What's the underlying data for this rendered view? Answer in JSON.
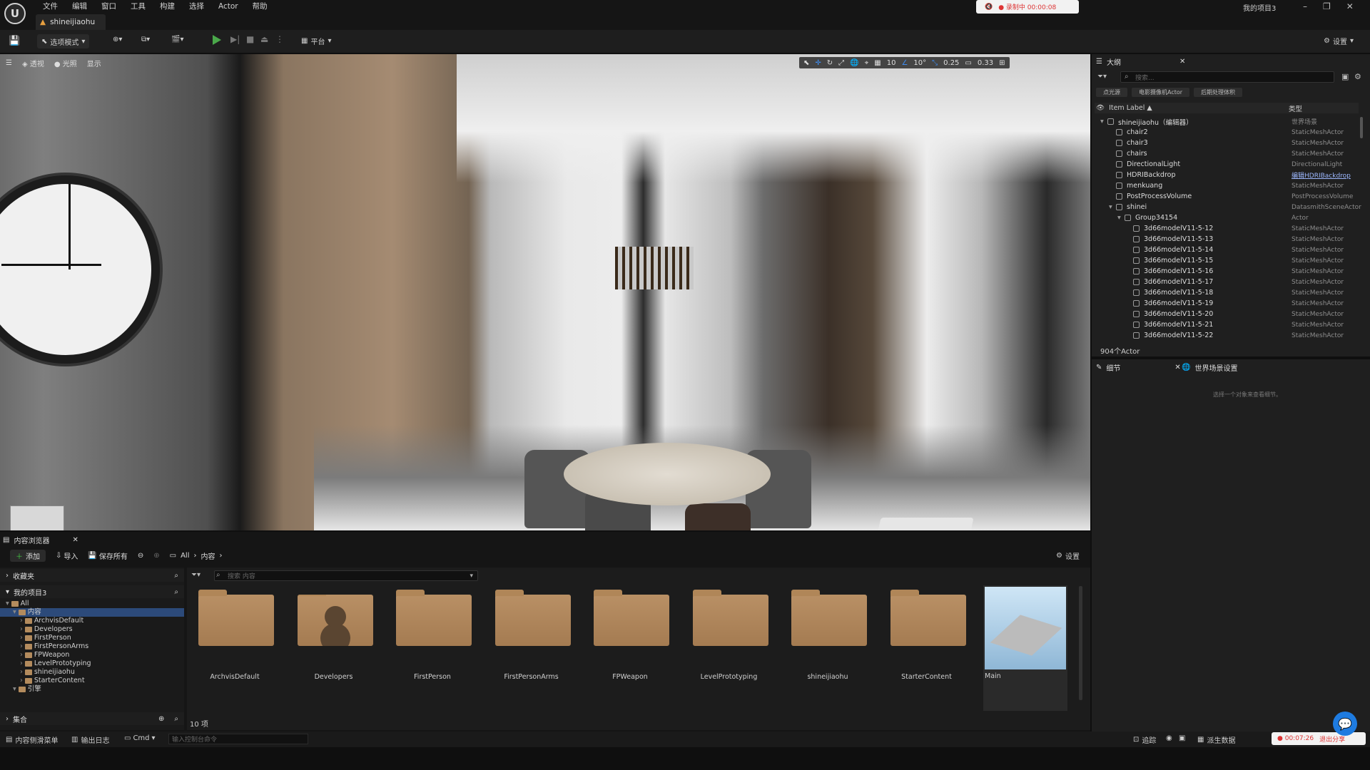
{
  "menu": [
    "文件",
    "编辑",
    "窗口",
    "工具",
    "构建",
    "选择",
    "Actor",
    "帮助"
  ],
  "doc_tab": "shineijiaohu",
  "recording": {
    "status": "● 录制中 00:00:08"
  },
  "project_name": "我的项目3",
  "toolbar": {
    "mode_label": "选项模式",
    "platform_label": "平台",
    "settings_label": "设置"
  },
  "viewport": {
    "view_mode": "透视",
    "lighting": "光照",
    "show": "显示",
    "grid_snap": "10",
    "rotate_snap": "10°",
    "scale_snap": "0.25",
    "camera_speed": "0.33"
  },
  "outliner": {
    "tab": "大纲",
    "search_placeholder": "搜索...",
    "filters": [
      "点光源",
      "电影摄像机Actor",
      "后期处理体积"
    ],
    "col_label": "Item Label ▲",
    "col_type": "类型",
    "rows": [
      {
        "label": "shineijiaohu（编辑器）",
        "type": "世界场景",
        "indent": 0,
        "link": false
      },
      {
        "label": "chair2",
        "type": "StaticMeshActor",
        "indent": 1,
        "link": false
      },
      {
        "label": "chair3",
        "type": "StaticMeshActor",
        "indent": 1,
        "link": false
      },
      {
        "label": "chairs",
        "type": "StaticMeshActor",
        "indent": 1,
        "link": false
      },
      {
        "label": "DirectionalLight",
        "type": "DirectionalLight",
        "indent": 1,
        "link": false
      },
      {
        "label": "HDRIBackdrop",
        "type": "编辑HDRIBackdrop",
        "indent": 1,
        "link": true
      },
      {
        "label": "menkuang",
        "type": "StaticMeshActor",
        "indent": 1,
        "link": false
      },
      {
        "label": "PostProcessVolume",
        "type": "PostProcessVolume",
        "indent": 1,
        "link": false
      },
      {
        "label": "shinei",
        "type": "DatasmithSceneActor",
        "indent": 1,
        "link": false
      },
      {
        "label": "Group34154",
        "type": "Actor",
        "indent": 2,
        "link": false
      },
      {
        "label": "3d66modelV11-5-12",
        "type": "StaticMeshActor",
        "indent": 3,
        "link": false
      },
      {
        "label": "3d66modelV11-5-13",
        "type": "StaticMeshActor",
        "indent": 3,
        "link": false
      },
      {
        "label": "3d66modelV11-5-14",
        "type": "StaticMeshActor",
        "indent": 3,
        "link": false
      },
      {
        "label": "3d66modelV11-5-15",
        "type": "StaticMeshActor",
        "indent": 3,
        "link": false
      },
      {
        "label": "3d66modelV11-5-16",
        "type": "StaticMeshActor",
        "indent": 3,
        "link": false
      },
      {
        "label": "3d66modelV11-5-17",
        "type": "StaticMeshActor",
        "indent": 3,
        "link": false
      },
      {
        "label": "3d66modelV11-5-18",
        "type": "StaticMeshActor",
        "indent": 3,
        "link": false
      },
      {
        "label": "3d66modelV11-5-19",
        "type": "StaticMeshActor",
        "indent": 3,
        "link": false
      },
      {
        "label": "3d66modelV11-5-20",
        "type": "StaticMeshActor",
        "indent": 3,
        "link": false
      },
      {
        "label": "3d66modelV11-5-21",
        "type": "StaticMeshActor",
        "indent": 3,
        "link": false
      },
      {
        "label": "3d66modelV11-5-22",
        "type": "StaticMeshActor",
        "indent": 3,
        "link": false
      }
    ],
    "count": "904个Actor"
  },
  "details": {
    "tab": "细节",
    "tab2": "世界场景设置",
    "hint": "选择一个对象来查看细节。"
  },
  "content_browser": {
    "tab": "内容浏览器",
    "add": "添加",
    "import": "导入",
    "save_all": "保存所有",
    "path_all": "All",
    "path_content": "内容",
    "settings": "设置",
    "favorites": "收藏夹",
    "project": "我的项目3",
    "collections": "集合",
    "search_placeholder": "搜索 内容",
    "tree": [
      {
        "label": "All",
        "indent": 0,
        "selected": false
      },
      {
        "label": "内容",
        "indent": 1,
        "selected": true
      },
      {
        "label": "ArchvisDefault",
        "indent": 2,
        "selected": false
      },
      {
        "label": "Developers",
        "indent": 2,
        "selected": false
      },
      {
        "label": "FirstPerson",
        "indent": 2,
        "selected": false
      },
      {
        "label": "FirstPersonArms",
        "indent": 2,
        "selected": false
      },
      {
        "label": "FPWeapon",
        "indent": 2,
        "selected": false
      },
      {
        "label": "LevelPrototyping",
        "indent": 2,
        "selected": false
      },
      {
        "label": "shineijiaohu",
        "indent": 2,
        "selected": false
      },
      {
        "label": "StarterContent",
        "indent": 2,
        "selected": false
      },
      {
        "label": "引擎",
        "indent": 1,
        "selected": false
      }
    ],
    "folders": [
      "ArchvisDefault",
      "Developers",
      "FirstPerson",
      "FirstPersonArms",
      "FPWeapon",
      "LevelPrototyping",
      "shineijiaohu",
      "StarterContent"
    ],
    "main_asset": "Main",
    "count": "10 项"
  },
  "statusbar": {
    "drawer": "内容侧滑菜单",
    "output_log": "输出日志",
    "cmd": "Cmd",
    "console_placeholder": "输入控制台命令",
    "trace": "追踪",
    "derived_data": "派生数据",
    "rec_time": "● 00:07:26",
    "stop_share": "退出分享"
  },
  "colors": {
    "accent": "#1e7be0",
    "selection": "#2c4a7a",
    "folder": "#b38b5d",
    "play": "#4aa84a"
  }
}
